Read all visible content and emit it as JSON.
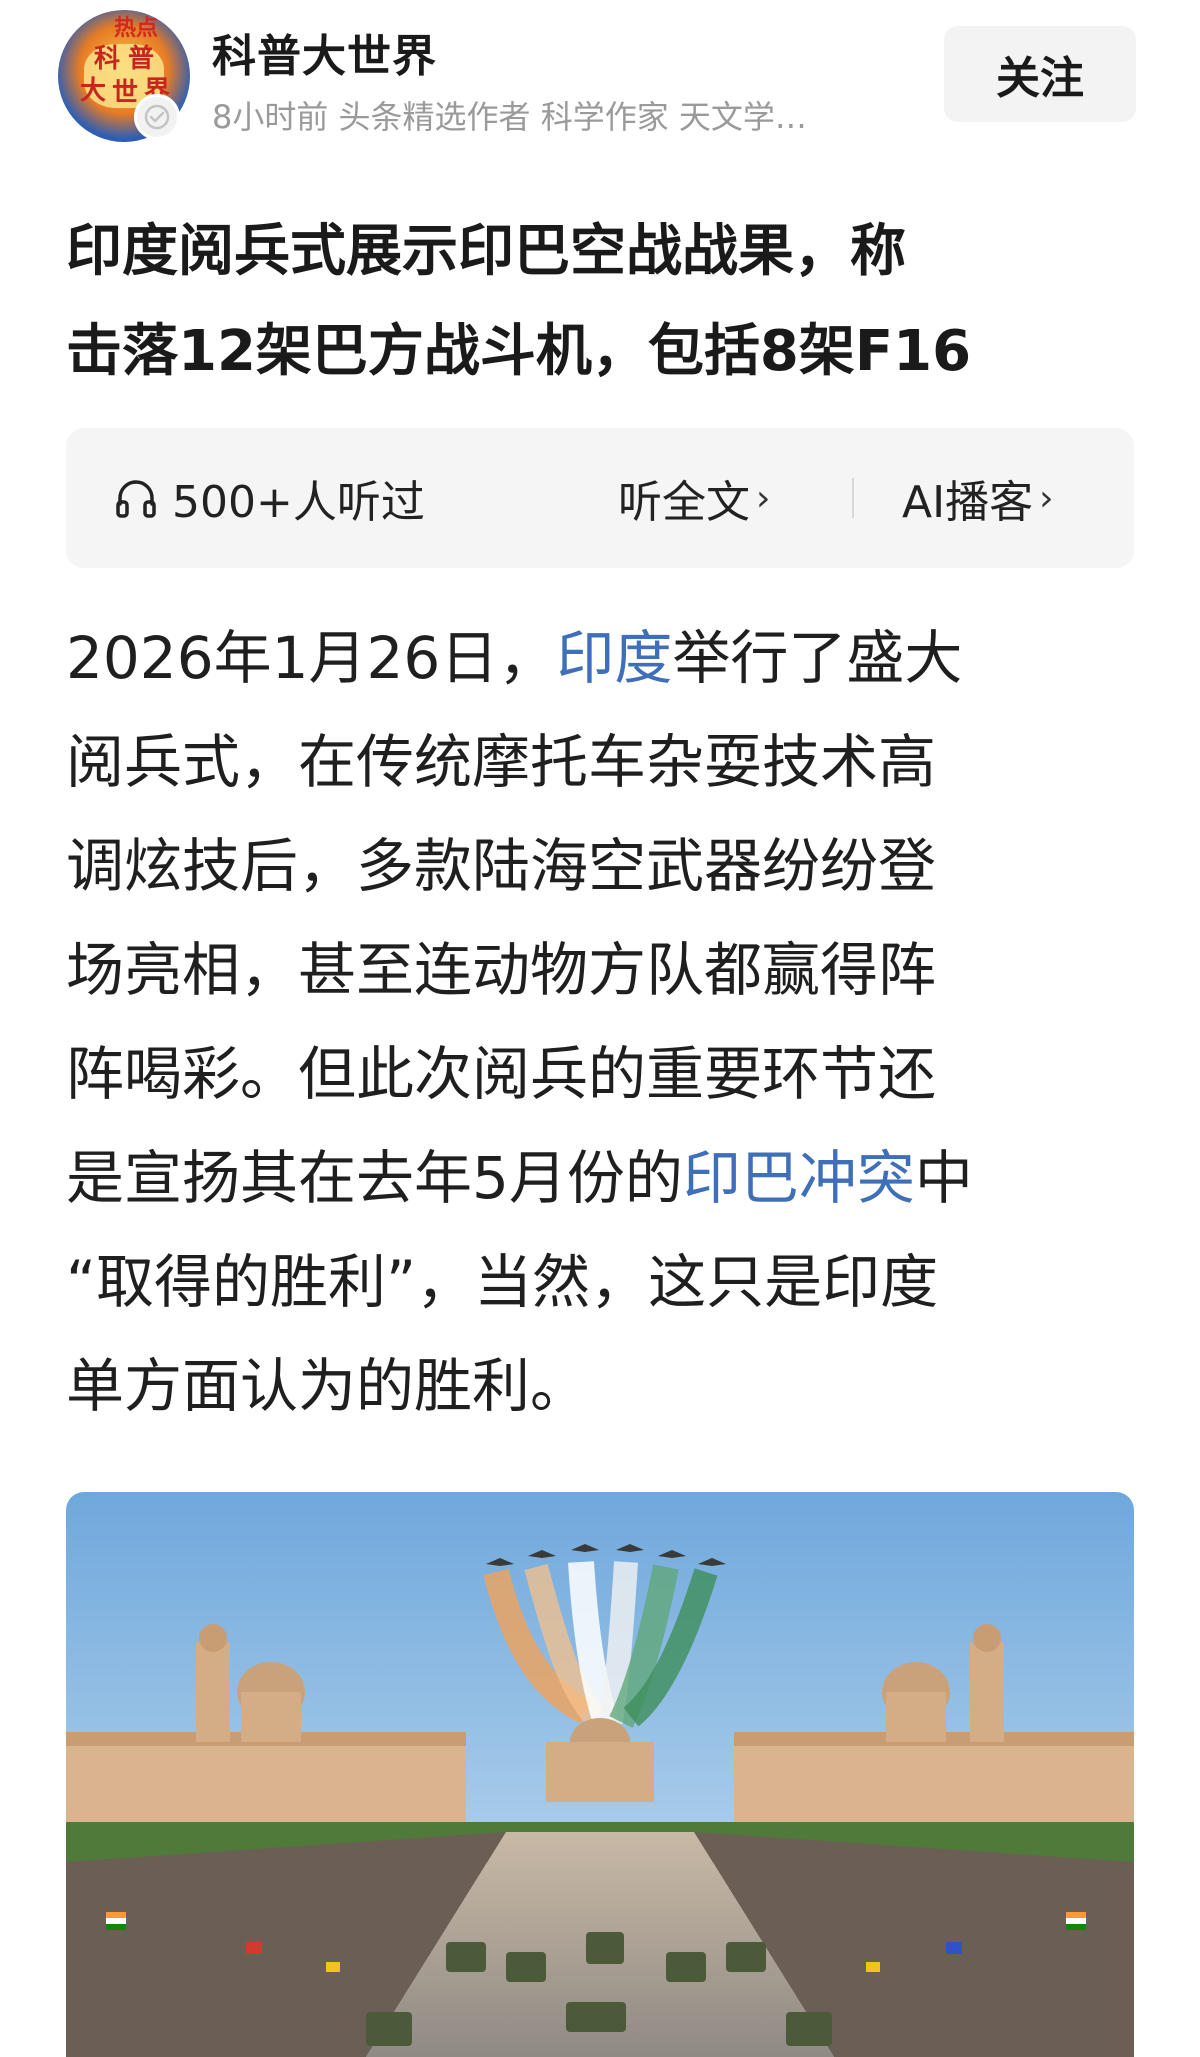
{
  "header": {
    "author_name": "科普大世界",
    "meta": "8小时前  头条精选作者 科学作家 天文学…",
    "follow_label": "关注",
    "avatar_text": [
      "热点",
      "科",
      "普",
      "大",
      "世",
      "界"
    ]
  },
  "title": {
    "line1": "印度阅兵式展示印巴空战战果，称",
    "line2": "击落12架巴方战斗机，包括8架F16"
  },
  "audio": {
    "listeners": "500+人听过",
    "listen_all": "听全文",
    "ai_podcast": "AI播客",
    "chevron": "›"
  },
  "body": {
    "l1_a": "2026年1月26日，",
    "l1_link": "印度",
    "l1_b": "举行了盛大",
    "l2": "阅兵式，在传统摩托车杂耍技术高",
    "l3": "调炫技后，多款陆海空武器纷纷登",
    "l4": "场亮相，甚至连动物方队都赢得阵",
    "l5": "阵喝彩。但此次阅兵的重要环节还",
    "l6_a": "是宣扬其在去年5月份的",
    "l6_link": "印巴冲突",
    "l6_b": "中",
    "l7": "“取得的胜利”，当然，这只是印度",
    "l8": "单方面认为的胜利。"
  },
  "colors": {
    "link": "#3f6fb8",
    "meta_gray": "#9a9a9a",
    "audio_bg": "#f5f5f5",
    "follow_bg": "#f3f3f3"
  }
}
